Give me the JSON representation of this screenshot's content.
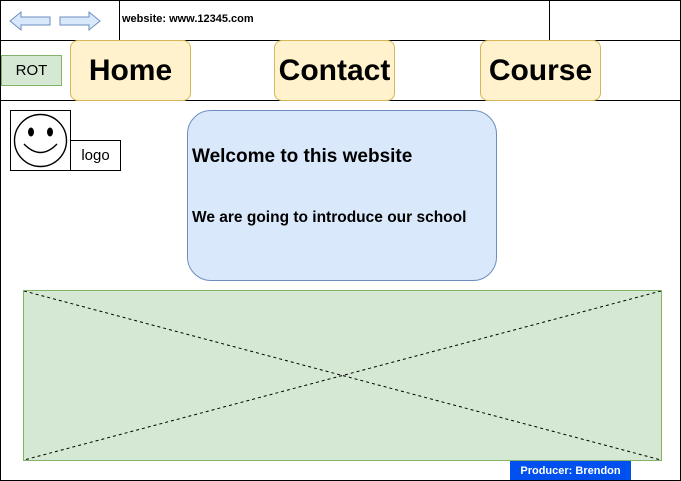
{
  "address_bar": {
    "url_text": "website:  www.12345.com",
    "back_icon": "left-arrow-icon",
    "forward_icon": "right-arrow-icon"
  },
  "nav": {
    "rot_label": "ROT",
    "items": [
      {
        "label": "Home"
      },
      {
        "label": "Contact"
      },
      {
        "label": "Course"
      }
    ]
  },
  "logo": {
    "icon": "smiley-icon",
    "label": "logo"
  },
  "welcome": {
    "title": "Welcome to this website",
    "subtitle": "We are going to introduce our school"
  },
  "image_placeholder": {
    "icon": "image-placeholder-cross"
  },
  "footer": {
    "producer": "Producer: Brendon"
  },
  "colors": {
    "nav_button_fill": "#fff2cc",
    "nav_button_stroke": "#d6b656",
    "green_fill": "#d5e8d4",
    "green_stroke": "#82b366",
    "blue_fill": "#dae8fc",
    "blue_stroke": "#6c8ebf",
    "producer_fill": "#0050ef"
  }
}
